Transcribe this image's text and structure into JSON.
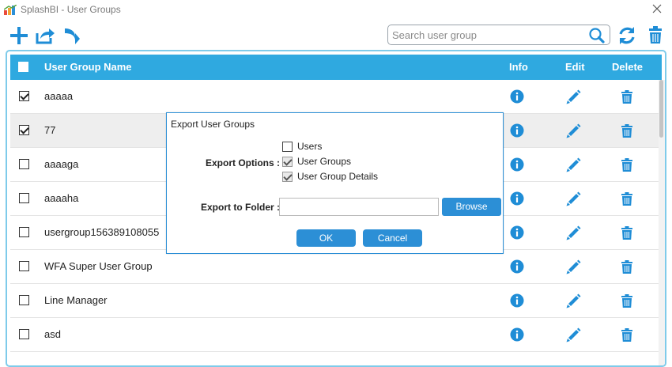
{
  "window": {
    "title": "SplashBI - User Groups"
  },
  "toolbar": {
    "add_icon": "plus-icon",
    "export_icon": "export-icon",
    "forward_icon": "arrow-forward-icon",
    "search_placeholder": "Search user group",
    "search_value": ""
  },
  "grid": {
    "headers": {
      "name": "User Group Name",
      "info": "Info",
      "edit": "Edit",
      "delete": "Delete"
    },
    "rows": [
      {
        "name": "aaaaa",
        "checked": true
      },
      {
        "name": "77",
        "checked": true
      },
      {
        "name": "aaaaga",
        "checked": false
      },
      {
        "name": "aaaaha",
        "checked": false
      },
      {
        "name": "usergroup156389108055",
        "checked": false
      },
      {
        "name": "WFA Super User Group",
        "checked": false
      },
      {
        "name": "Line Manager",
        "checked": false
      },
      {
        "name": "asd",
        "checked": false
      }
    ]
  },
  "dialog": {
    "title": "Export User Groups",
    "export_options_label": "Export Options :",
    "options": [
      {
        "label": "Users",
        "checked": false
      },
      {
        "label": "User Groups",
        "checked": true
      },
      {
        "label": "User Group Details",
        "checked": true
      }
    ],
    "folder_label": "Export to Folder :",
    "folder_value": "",
    "browse_label": "Browse",
    "ok_label": "OK",
    "cancel_label": "Cancel"
  },
  "colors": {
    "header_blue": "#2fa9e0",
    "icon_blue": "#1f8dd6",
    "button_blue": "#2c8fd6",
    "grid_border": "#7ecbea"
  }
}
